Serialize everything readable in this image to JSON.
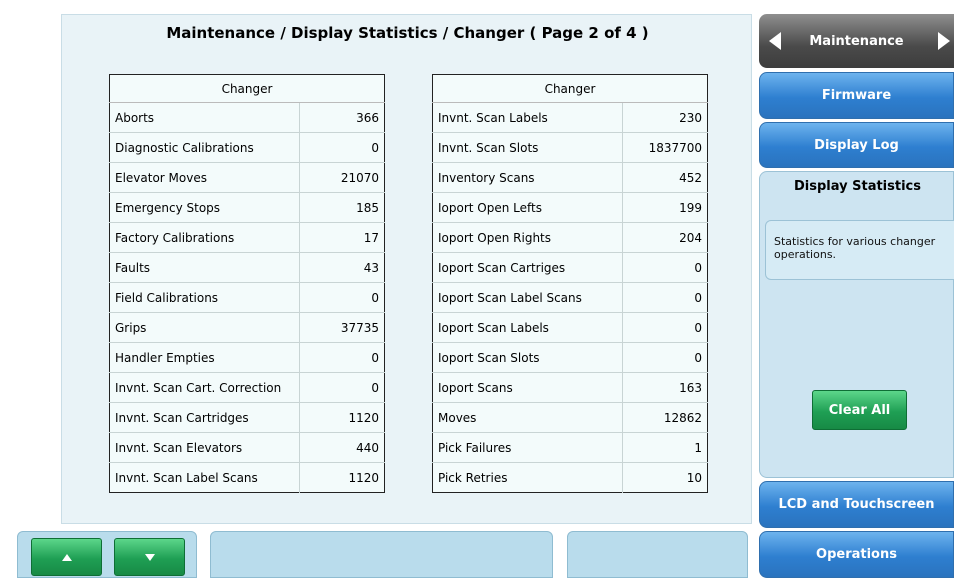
{
  "page": {
    "title": "Maintenance / Display Statistics / Changer ( Page 2 of 4 )"
  },
  "left_table": {
    "header": "Changer",
    "rows": [
      {
        "label": "Aborts",
        "value": "366"
      },
      {
        "label": "Diagnostic Calibrations",
        "value": "0"
      },
      {
        "label": "Elevator Moves",
        "value": "21070"
      },
      {
        "label": "Emergency Stops",
        "value": "185"
      },
      {
        "label": "Factory Calibrations",
        "value": "17"
      },
      {
        "label": "Faults",
        "value": "43"
      },
      {
        "label": "Field Calibrations",
        "value": "0"
      },
      {
        "label": "Grips",
        "value": "37735"
      },
      {
        "label": "Handler Empties",
        "value": "0"
      },
      {
        "label": "Invnt. Scan Cart. Correction",
        "value": "0"
      },
      {
        "label": "Invnt. Scan Cartridges",
        "value": "1120"
      },
      {
        "label": "Invnt. Scan Elevators",
        "value": "440"
      },
      {
        "label": "Invnt. Scan Label Scans",
        "value": "1120"
      }
    ]
  },
  "right_table": {
    "header": "Changer",
    "rows": [
      {
        "label": "Invnt. Scan Labels",
        "value": "230"
      },
      {
        "label": "Invnt. Scan Slots",
        "value": "1837700"
      },
      {
        "label": "Inventory Scans",
        "value": "452"
      },
      {
        "label": "Ioport Open Lefts",
        "value": "199"
      },
      {
        "label": "Ioport Open Rights",
        "value": "204"
      },
      {
        "label": "Ioport Scan Cartriges",
        "value": "0"
      },
      {
        "label": "Ioport Scan Label Scans",
        "value": "0"
      },
      {
        "label": "Ioport Scan Labels",
        "value": "0"
      },
      {
        "label": "Ioport Scan Slots",
        "value": "0"
      },
      {
        "label": "Ioport Scans",
        "value": "163"
      },
      {
        "label": "Moves",
        "value": "12862"
      },
      {
        "label": "Pick Failures",
        "value": "1"
      },
      {
        "label": "Pick Retries",
        "value": "10"
      }
    ]
  },
  "nav": {
    "header": "Maintenance",
    "firmware": "Firmware",
    "display_log": "Display Log",
    "selected": "Display Statistics",
    "selected_description": "Statistics for various changer operations.",
    "clear_all": "Clear All",
    "lcd": "LCD and Touchscreen",
    "operations": "Operations"
  },
  "icons": {
    "nav_prev": "triangle-left-icon",
    "nav_next": "triangle-right-icon",
    "page_up": "arrow-up-icon",
    "page_down": "arrow-down-icon"
  },
  "colors": {
    "nav_blue": "#2e7fd0",
    "nav_header": "#4a4a4a",
    "green_button": "#1f9f54",
    "panel_bg": "#e9f3f7"
  }
}
